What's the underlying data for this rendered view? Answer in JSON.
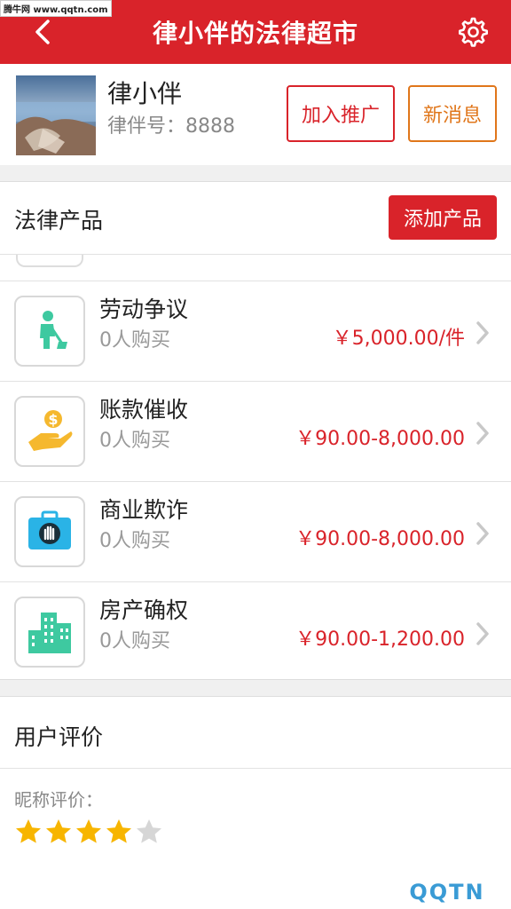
{
  "watermark_top": "腾牛网 www.qqtn.com",
  "header": {
    "title": "律小伴的法律超市"
  },
  "profile": {
    "name": "律小伴",
    "id_label": "律伴号：",
    "id_value": "8888",
    "promote_button": "加入推广",
    "message_button": "新消息"
  },
  "products": {
    "section_title": "法律产品",
    "add_button": "添加产品",
    "items": [
      {
        "name": "劳动争议",
        "buyers": "0人购买",
        "price": "￥5,000.00/件",
        "icon": "worker-shovel-icon",
        "icon_color": "#3ec9a0"
      },
      {
        "name": "账款催收",
        "buyers": "0人购买",
        "price": "￥90.00-8,000.00",
        "icon": "hand-money-icon",
        "icon_color": "#f5b82e"
      },
      {
        "name": "商业欺诈",
        "buyers": "0人购买",
        "price": "￥90.00-8,000.00",
        "icon": "stop-hand-briefcase-icon",
        "icon_color": "#2ab3e6"
      },
      {
        "name": "房产确权",
        "buyers": "0人购买",
        "price": "￥90.00-1,200.00",
        "icon": "buildings-icon",
        "icon_color": "#3ec9a0"
      }
    ]
  },
  "reviews": {
    "section_title": "用户评价",
    "label": "昵称评价：",
    "rating": 4,
    "max_rating": 5
  },
  "watermark_bottom": "QQTN",
  "colors": {
    "brand_red": "#d9232a",
    "accent_orange": "#e0761a",
    "price_red": "#d9232a"
  }
}
